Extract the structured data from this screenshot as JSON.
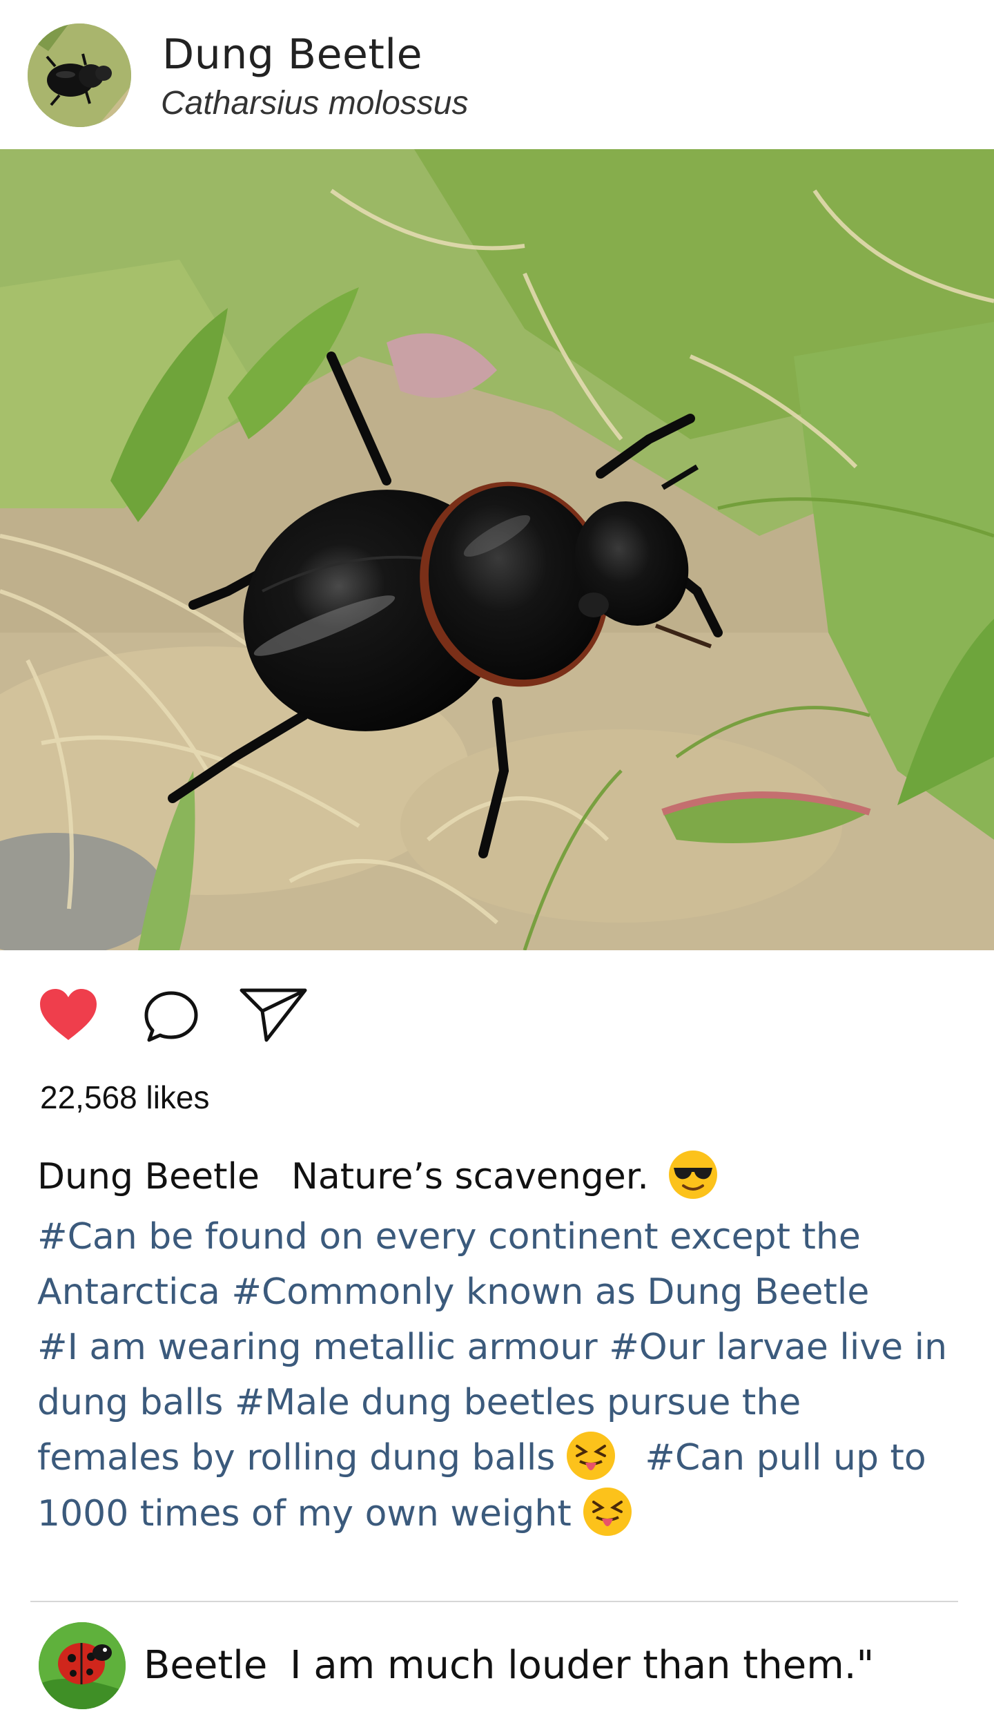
{
  "post": {
    "account_name": "Dung Beetle",
    "species": "Catharsius molossus",
    "likes": "22,568 likes",
    "liked": true,
    "accent_color": "#ef3e4c",
    "hashtag_color": "#3b5a7c"
  },
  "actions": {
    "like_icon": "heart-icon",
    "comment_icon": "comment-bubble-icon",
    "share_icon": "paper-plane-icon"
  },
  "caption": {
    "username": "Dung Beetle",
    "text": "Nature’s scavenger.",
    "emoji_icon": "sunglasses-face-emoji",
    "hashtag_lines": [
      "#Can be found on every continent except the",
      "Antarctica  #Commonly known as Dung Beetle",
      "#I am wearing metallic armour #Our larvae live in",
      "dung balls #Male dung beetles pursue the",
      "females by rolling dung balls",
      "#Can pull up to",
      "1000 times of my own weight"
    ],
    "tongue_emoji_icon": "squinting-tongue-face-emoji"
  },
  "comment": {
    "username": "Beetle",
    "text": "I am much louder than them.\""
  }
}
